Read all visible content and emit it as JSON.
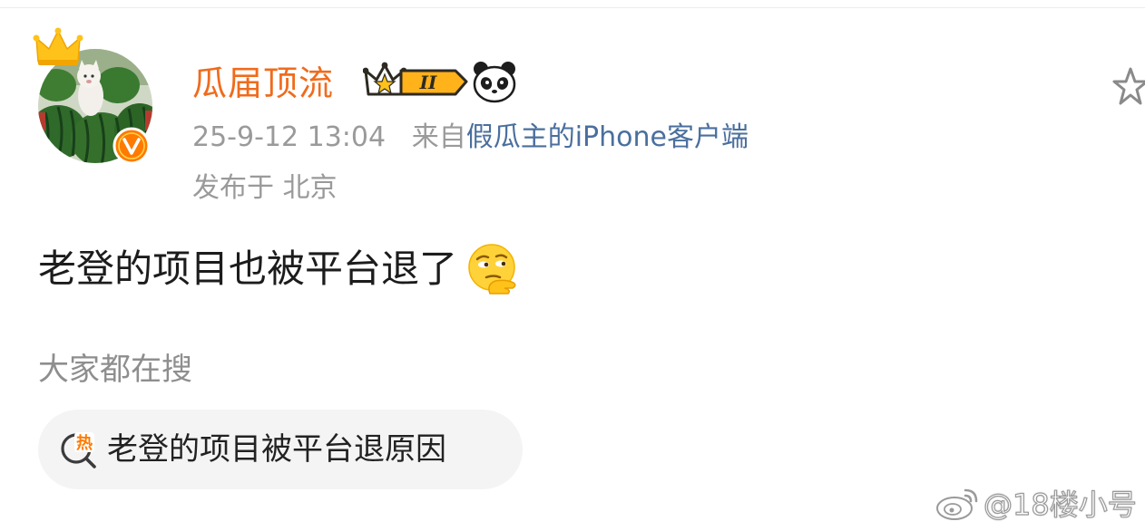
{
  "post": {
    "username": "瓜届顶流",
    "vip_level": "II",
    "timestamp": "25-9-12 13:04",
    "source_prefix": "来自",
    "source_name": "假瓜主的iPhone客户端",
    "location": "发布于 北京",
    "body": "老登的项目也被平台退了"
  },
  "search": {
    "heading": "大家都在搜",
    "hot_icon_char": "热",
    "chip_text": "老登的项目被平台退原因"
  },
  "watermark": {
    "text": "@18楼小号"
  },
  "icons": {
    "crown": "crown-icon",
    "verified": "verified-icon",
    "vip": "vip-badge-icon",
    "panda": "panda-icon",
    "star": "star-icon",
    "emoji": "thinking-emoji-icon",
    "hot_search": "hot-search-icon",
    "weibo": "weibo-logo-icon"
  },
  "colors": {
    "username": "#f06b1c",
    "meta": "#9a9a9a",
    "source_link": "#4a6f9e",
    "body": "#1c1c1c",
    "chip_bg": "#f4f4f4",
    "verified": "#ff7a00"
  }
}
